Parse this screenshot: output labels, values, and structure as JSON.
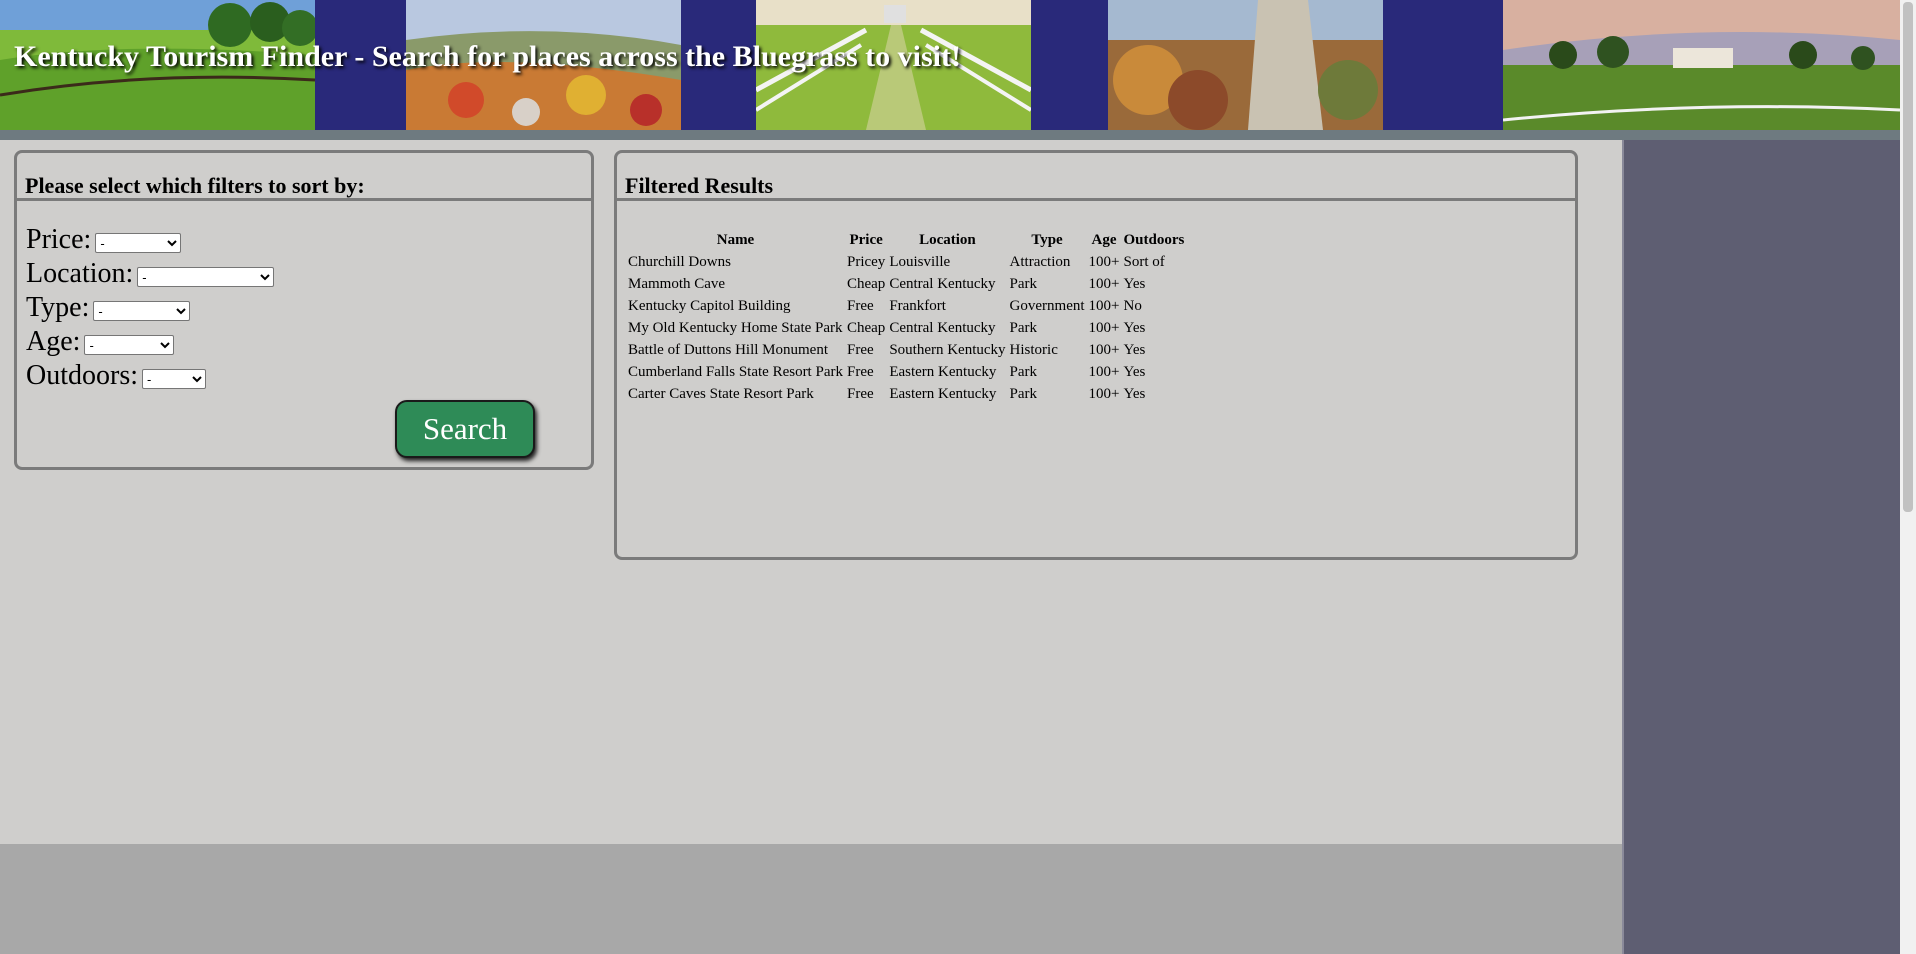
{
  "header": {
    "title": "Kentucky Tourism Finder - Search for places across the Bluegrass to visit!"
  },
  "filters": {
    "heading": "Please select which filters to sort by:",
    "price_label": "Price:",
    "price_value": "-",
    "location_label": "Location:",
    "location_value": "-",
    "type_label": "Type:",
    "type_value": "-",
    "age_label": "Age:",
    "age_value": "-",
    "outdoors_label": "Outdoors:",
    "outdoors_value": "-",
    "search_label": "Search"
  },
  "results": {
    "heading": "Filtered Results",
    "columns": [
      "Name",
      "Price",
      "Location",
      "Type",
      "Age",
      "Outdoors"
    ],
    "rows": [
      [
        "Churchill Downs",
        "Pricey",
        "Louisville",
        "Attraction",
        "100+",
        "Sort of"
      ],
      [
        "Mammoth Cave",
        "Cheap",
        "Central Kentucky",
        "Park",
        "100+",
        "Yes"
      ],
      [
        "Kentucky Capitol Building",
        "Free",
        "Frankfort",
        "Government",
        "100+",
        "No"
      ],
      [
        "My Old Kentucky Home State Park",
        "Cheap",
        "Central Kentucky",
        "Park",
        "100+",
        "Yes"
      ],
      [
        "Battle of Duttons Hill Monument",
        "Free",
        "Southern Kentucky",
        "Historic",
        "100+",
        "Yes"
      ],
      [
        "Cumberland Falls State Resort Park",
        "Free",
        "Eastern Kentucky",
        "Park",
        "100+",
        "Yes"
      ],
      [
        "Carter Caves State Resort Park",
        "Free",
        "Eastern Kentucky",
        "Park",
        "100+",
        "Yes"
      ]
    ]
  },
  "colors": {
    "banner_bg": "#29297a",
    "page_bg": "#cfcecc",
    "search_button": "#2e8b57",
    "sidebar": "#5e5e72"
  },
  "icons": [
    "farm-photo",
    "autumn-valley-photo",
    "fence-path-photo",
    "rock-cliff-photo",
    "horse-farm-photo"
  ]
}
